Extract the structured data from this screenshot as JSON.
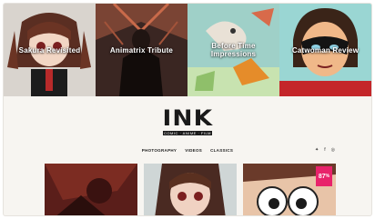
{
  "banner": {
    "items": [
      {
        "title": "Sakura Revisited",
        "icon": "anime-girl-illustration"
      },
      {
        "title": "Animatrix Tribute",
        "icon": "dark-figure-illustration"
      },
      {
        "title_lines": [
          "Before Time",
          "Impressions"
        ],
        "icon": "dinosaur-illustration"
      },
      {
        "title": "Catwoman Review",
        "icon": "masked-hero-illustration"
      }
    ]
  },
  "logo": {
    "text": "INK",
    "tagline": "COMIC · ANIME · FILM"
  },
  "nav": {
    "items": [
      "PHOTOGRAPHY",
      "VIDEOS",
      "CLASSICS"
    ]
  },
  "social": {
    "icons": [
      "twitter-icon",
      "facebook-icon",
      "instagram-icon"
    ],
    "glyphs": [
      "✦",
      "f",
      "◎"
    ]
  },
  "cards": {
    "score": "87",
    "score_suffix": "%",
    "items": [
      {
        "icon": "dark-red-artwork"
      },
      {
        "icon": "anime-girl-artwork"
      },
      {
        "icon": "cartoon-eyes-artwork"
      }
    ]
  },
  "colors": {
    "accent": "#e8236b",
    "background": "#f7f5f1",
    "logo": "#1a1a1a"
  }
}
